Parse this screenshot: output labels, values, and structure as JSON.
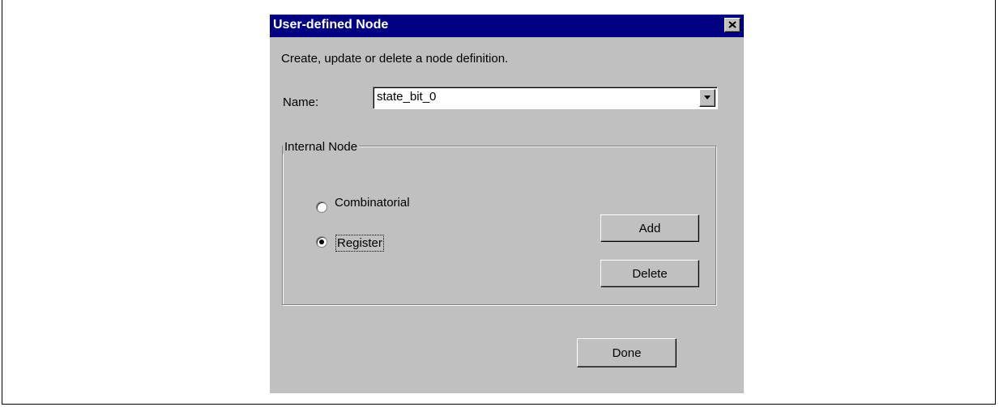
{
  "dialog": {
    "title": "User-defined Node",
    "description": "Create, update or delete a node definition.",
    "name_label": "Name:",
    "name_value": "state_bit_0",
    "group": {
      "label": "Internal Node",
      "options": [
        {
          "label": "Combinatorial",
          "selected": false
        },
        {
          "label": "Register",
          "selected": true
        }
      ]
    },
    "buttons": {
      "add": "Add",
      "delete": "Delete",
      "done": "Done"
    }
  },
  "icons": {
    "close": "close-icon",
    "dropdown": "chevron-down-icon"
  },
  "colors": {
    "titlebar": "#000080",
    "dialog_bg": "#c0c0c0"
  }
}
